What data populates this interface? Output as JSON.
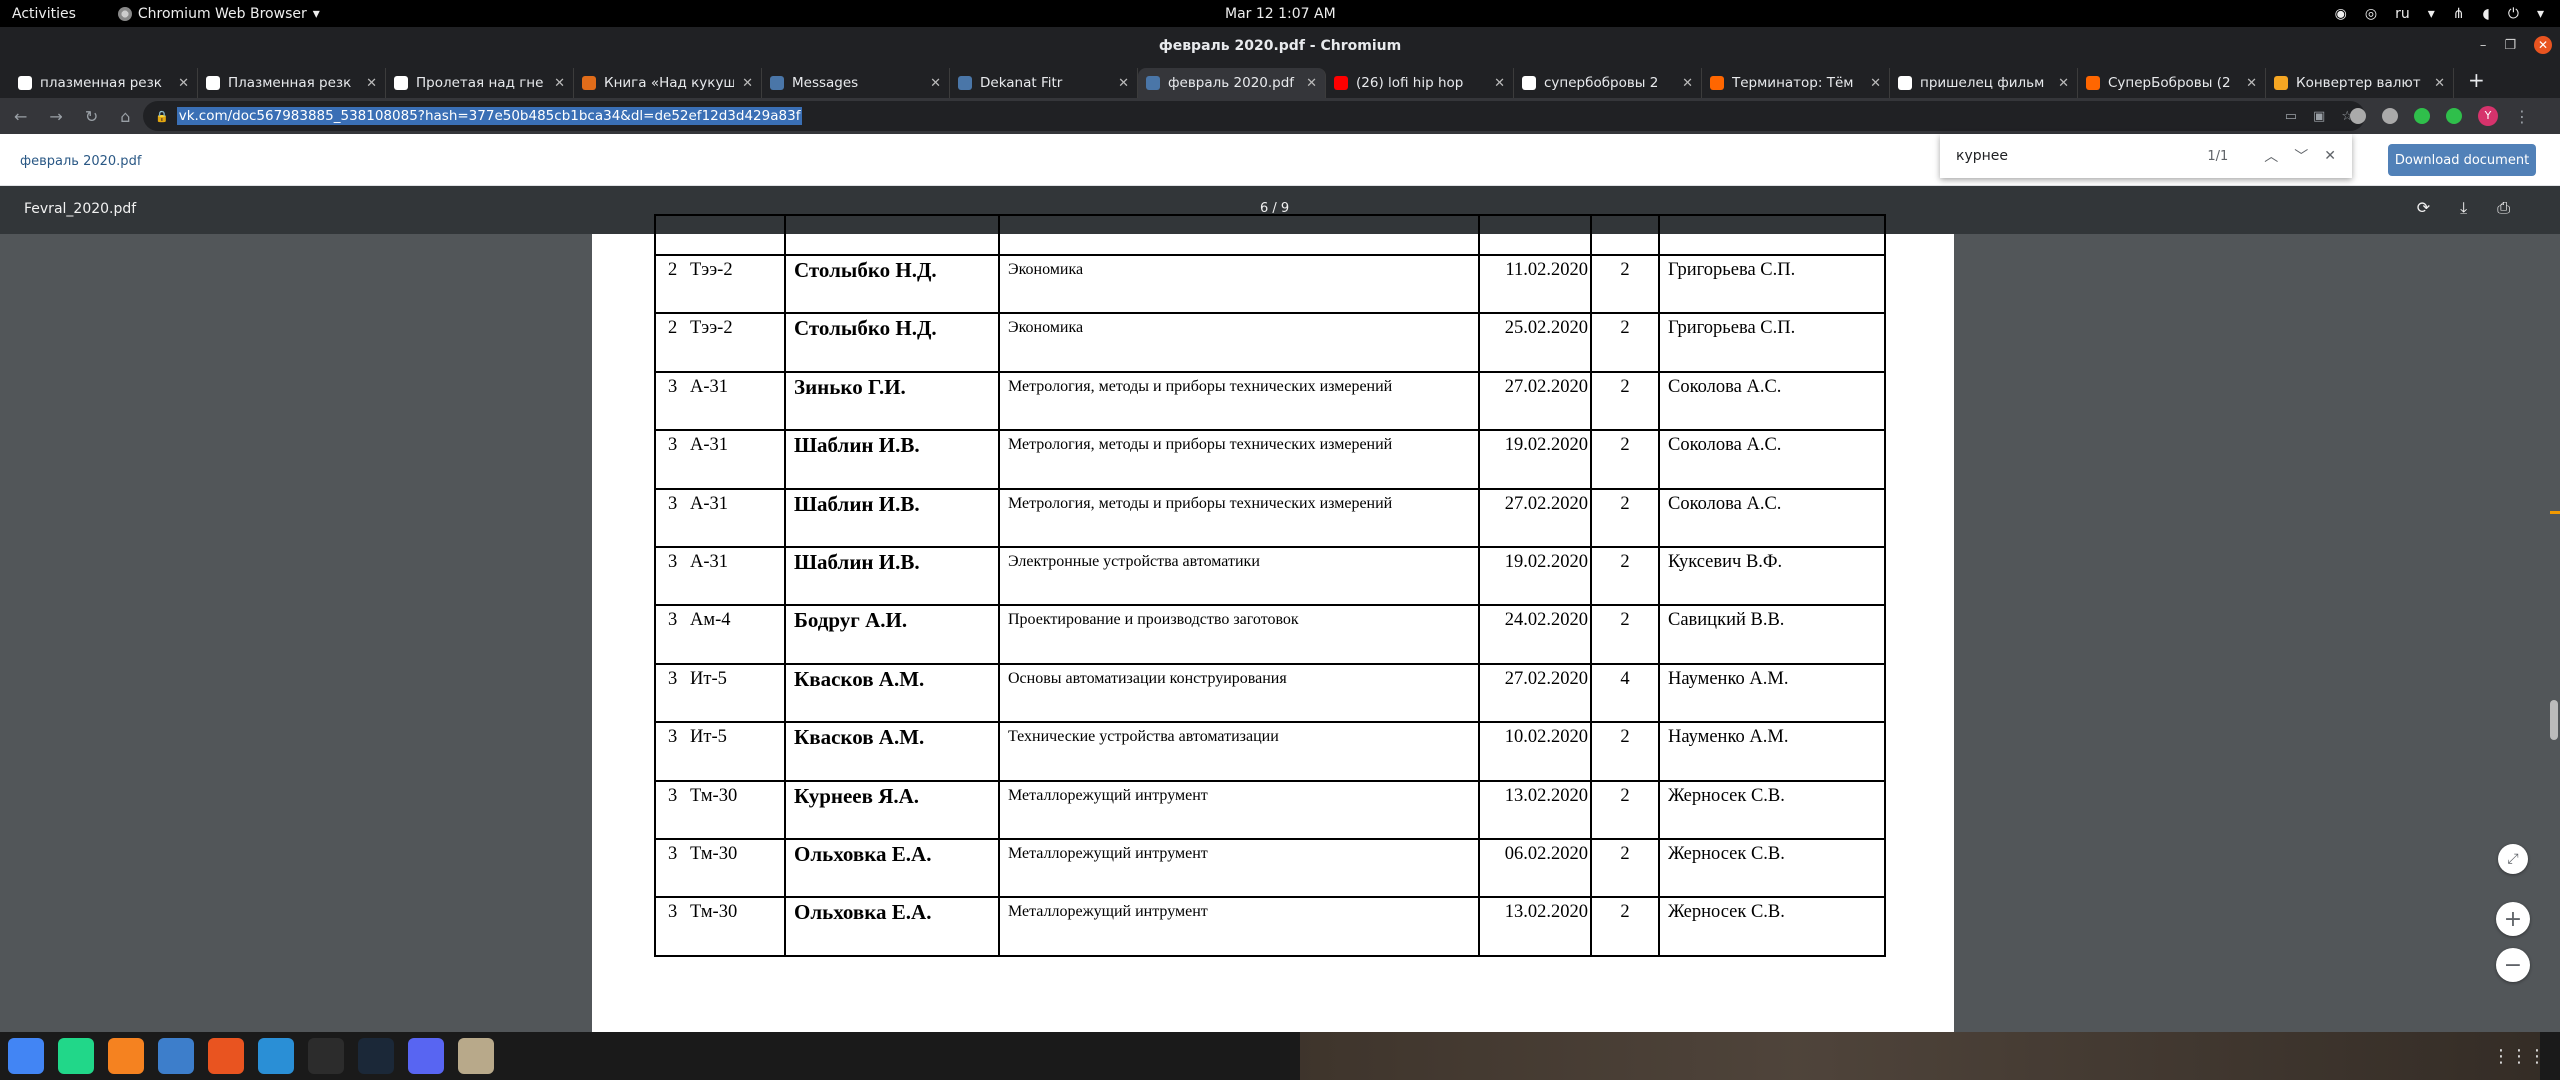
{
  "topbar": {
    "activities": "Activities",
    "app_name": "Chromium Web Browser",
    "clock": "Mar 12  1:07 AM",
    "lang": "ru"
  },
  "window": {
    "title": "февраль 2020.pdf - Chromium"
  },
  "tabs": [
    {
      "title": "плазменная резк",
      "favicon": "google-icon",
      "color": "#ffffff"
    },
    {
      "title": "Плазменная резк",
      "favicon": "wikipedia-icon",
      "color": "#ffffff"
    },
    {
      "title": "Пролетая над гне",
      "favicon": "wikipedia-icon",
      "color": "#ffffff"
    },
    {
      "title": "Книга «Над кукуш",
      "favicon": "book-icon",
      "color": "#e06c1a"
    },
    {
      "title": "Messages",
      "favicon": "messages-icon",
      "color": "#4a76a8"
    },
    {
      "title": "Dekanat Fitr",
      "favicon": "vk-icon",
      "color": "#4a76a8"
    },
    {
      "title": "февраль 2020.pdf",
      "favicon": "vk-icon",
      "color": "#4a76a8",
      "active": true
    },
    {
      "title": "(26) lofi hip hop",
      "favicon": "youtube-icon",
      "color": "#ff0000"
    },
    {
      "title": "супербобровы 2",
      "favicon": "google-icon",
      "color": "#ffffff"
    },
    {
      "title": "Терминатор: Тём",
      "favicon": "kinopoisk-icon",
      "color": "#ff6600"
    },
    {
      "title": "пришелец фильм",
      "favicon": "google-icon",
      "color": "#ffffff"
    },
    {
      "title": "СуперБобровы (2",
      "favicon": "kinopoisk-icon",
      "color": "#ff6600"
    },
    {
      "title": "Конвертер валют",
      "favicon": "converter-icon",
      "color": "#f5a623"
    }
  ],
  "omnibox": {
    "url": "vk.com/doc567983885_538108085?hash=377e50b485cb1bca34&dl=de52ef12d3d429a83f"
  },
  "vk": {
    "doc_link": "февраль 2020.pdf",
    "download_label": "Download document"
  },
  "find": {
    "query": "курнее",
    "count": "1/1"
  },
  "pdf": {
    "filename": "Fevral_2020.pdf",
    "page_indicator": "6 / 9"
  },
  "table_rows": [
    {
      "course": "",
      "group": "",
      "student": "",
      "subject": "",
      "date": "",
      "hours": "",
      "teacher": ""
    },
    {
      "course": "2",
      "group": "Тээ-2",
      "student": "Столыбко Н.Д.",
      "subject": "Экономика",
      "date": "11.02.2020",
      "hours": "2",
      "teacher": "Григорьева С.П."
    },
    {
      "course": "2",
      "group": "Тээ-2",
      "student": "Столыбко Н.Д.",
      "subject": "Экономика",
      "date": "25.02.2020",
      "hours": "2",
      "teacher": "Григорьева С.П."
    },
    {
      "course": "3",
      "group": "А-31",
      "student": "Зинько Г.И.",
      "subject": "Метрология, методы и приборы технических измерений",
      "date": "27.02.2020",
      "hours": "2",
      "teacher": "Соколова А.С."
    },
    {
      "course": "3",
      "group": "А-31",
      "student": "Шаблин И.В.",
      "subject": "Метрология, методы и приборы технических измерений",
      "date": "19.02.2020",
      "hours": "2",
      "teacher": "Соколова А.С."
    },
    {
      "course": "3",
      "group": "А-31",
      "student": "Шаблин И.В.",
      "subject": "Метрология, методы и приборы технических измерений",
      "date": "27.02.2020",
      "hours": "2",
      "teacher": "Соколова А.С."
    },
    {
      "course": "3",
      "group": "А-31",
      "student": "Шаблин И.В.",
      "subject": "Электронные устройства автоматики",
      "date": "19.02.2020",
      "hours": "2",
      "teacher": "Куксевич В.Ф."
    },
    {
      "course": "3",
      "group": "Ам-4",
      "student": "Бодруг А.И.",
      "subject": "Проектирование и производство заготовок",
      "date": "24.02.2020",
      "hours": "2",
      "teacher": "Савицкий В.В."
    },
    {
      "course": "3",
      "group": "Ит-5",
      "student": "Квасков А.М.",
      "subject": "Основы автоматизации конструирования",
      "date": "27.02.2020",
      "hours": "4",
      "teacher": "Науменко А.М."
    },
    {
      "course": "3",
      "group": "Ит-5",
      "student": "Квасков А.М.",
      "subject": "Технические устройства автоматизации",
      "date": "10.02.2020",
      "hours": "2",
      "teacher": "Науменко А.М."
    },
    {
      "course": "3",
      "group": "Тм-30",
      "student": "Курнеев Я.А.",
      "subject": "Металлорежущий интрумент",
      "date": "13.02.2020",
      "hours": "2",
      "teacher": "Жерносек С.В."
    },
    {
      "course": "3",
      "group": "Тм-30",
      "student": "Ольховка Е.А.",
      "subject": "Металлорежущий интрумент",
      "date": "06.02.2020",
      "hours": "2",
      "teacher": "Жерносек С.В."
    },
    {
      "course": "3",
      "group": "Тм-30",
      "student": "Ольховка Е.А.",
      "subject": "Металлорежущий интрумент",
      "date": "13.02.2020",
      "hours": "2",
      "teacher": "Жерносек С.В."
    }
  ],
  "dock": [
    {
      "name": "chromium-icon",
      "color": "#4285f4"
    },
    {
      "name": "pycharm-icon",
      "color": "#21d789"
    },
    {
      "name": "vlc-icon",
      "color": "#f58220"
    },
    {
      "name": "text-editor-icon",
      "color": "#3d7ecb"
    },
    {
      "name": "software-center-icon",
      "color": "#e95420"
    },
    {
      "name": "help-icon",
      "color": "#2a8fd6"
    },
    {
      "name": "terminal-icon",
      "color": "#2c2c2c"
    },
    {
      "name": "steam-icon",
      "color": "#1b2838"
    },
    {
      "name": "discord-icon",
      "color": "#5865f2"
    },
    {
      "name": "files-icon",
      "color": "#b8a98a"
    }
  ]
}
